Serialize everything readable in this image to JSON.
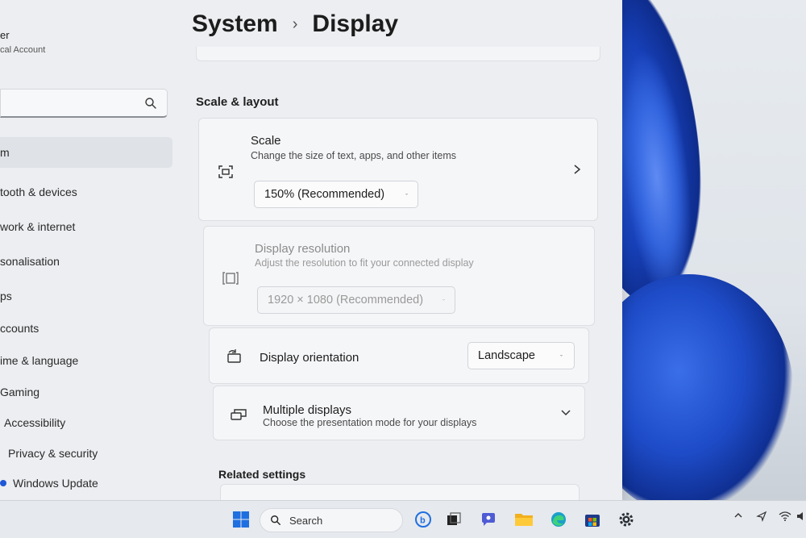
{
  "sidebar": {
    "user_name": "er",
    "user_sub": "cal Account",
    "items": [
      {
        "label": "m",
        "active": true
      },
      {
        "label": "tooth & devices"
      },
      {
        "label": "work & internet"
      },
      {
        "label": "sonalisation"
      },
      {
        "label": "ps"
      },
      {
        "label": "ccounts"
      },
      {
        "label": "ime & language"
      },
      {
        "label": "Gaming"
      },
      {
        "label": "Accessibility"
      },
      {
        "label": "Privacy & security"
      },
      {
        "label": "Windows Update"
      }
    ]
  },
  "breadcrumb": {
    "parent": "System",
    "separator": "›",
    "current": "Display"
  },
  "sections": {
    "scale_layout": "Scale & layout",
    "related": "Related settings"
  },
  "scale": {
    "title": "Scale",
    "subtitle": "Change the size of text, apps, and other items",
    "value": "150% (Recommended)"
  },
  "resolution": {
    "title": "Display resolution",
    "subtitle": "Adjust the resolution to fit your connected display",
    "value": "1920 × 1080 (Recommended)"
  },
  "orientation": {
    "title": "Display orientation",
    "value": "Landscape"
  },
  "multiple": {
    "title": "Multiple displays",
    "subtitle": "Choose the presentation mode for your displays"
  },
  "taskbar": {
    "search_label": "Search",
    "icons": [
      "windows-start-icon",
      "bing-icon",
      "task-view-icon",
      "chat-icon",
      "file-explorer-icon",
      "edge-icon",
      "store-icon",
      "settings-icon"
    ]
  },
  "colors": {
    "accent": "#1f57d6",
    "window_bg": "#eceef1",
    "card_bg": "#f5f6f8"
  }
}
